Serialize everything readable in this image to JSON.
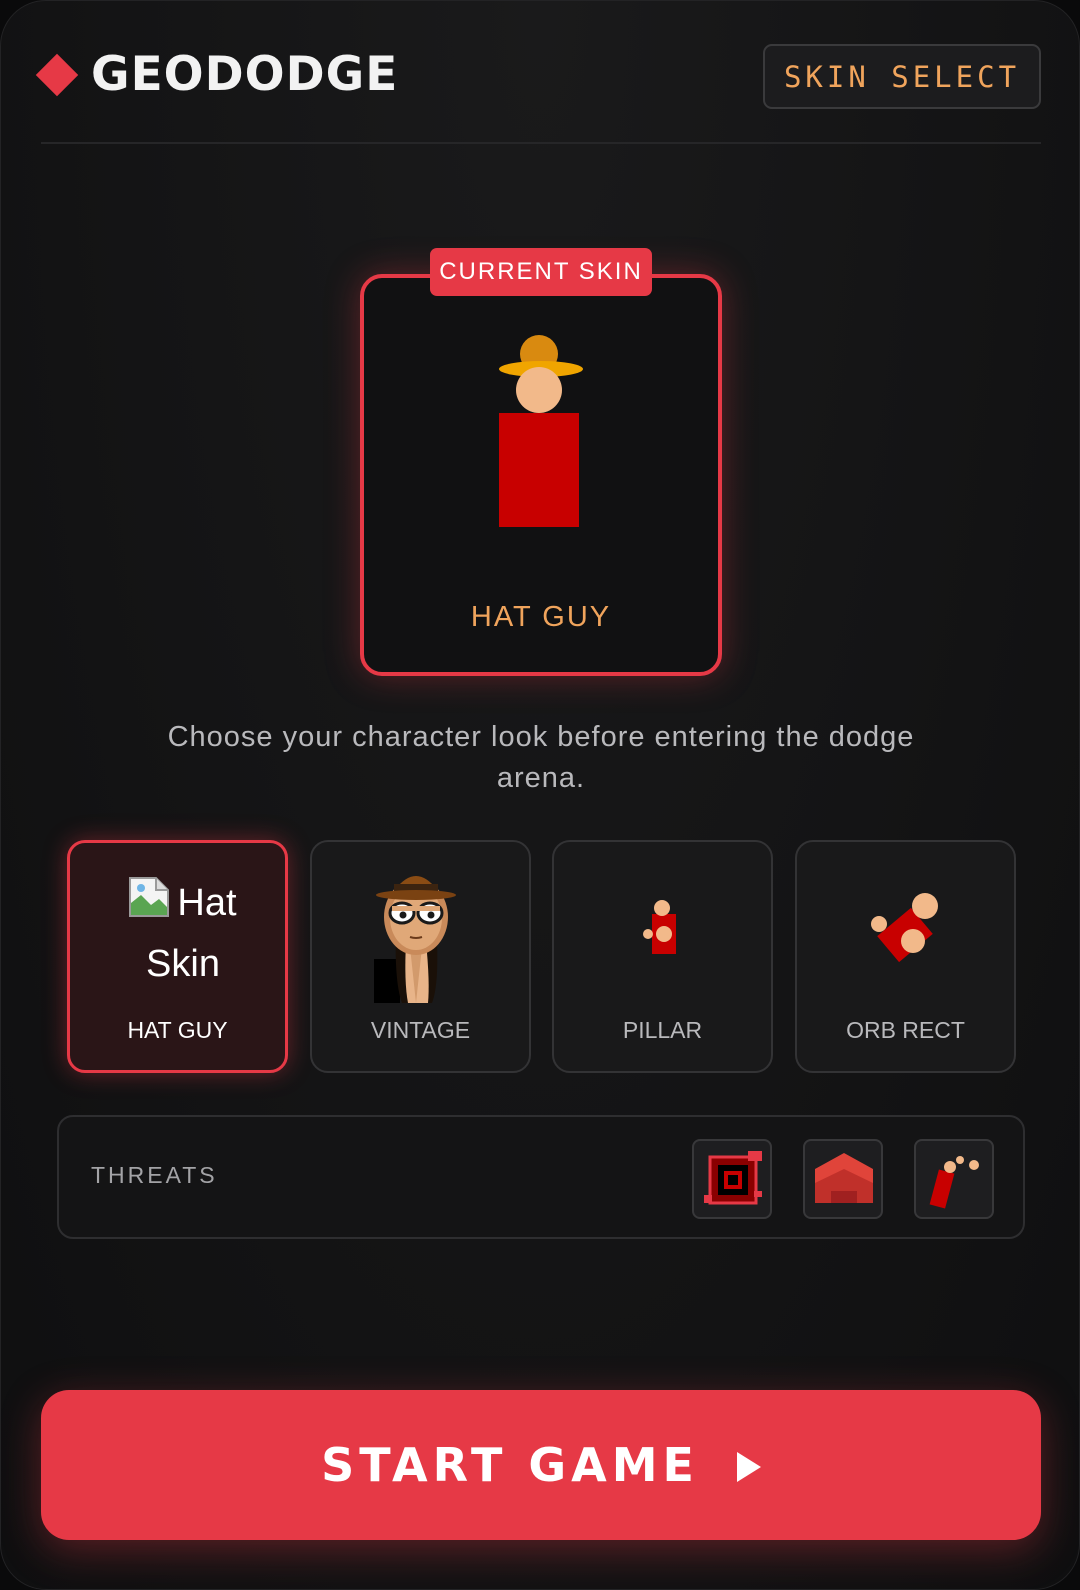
{
  "app": {
    "title": "GEODODGE",
    "skin_select_label": "SKIN SELECT",
    "accent_color": "#e63946",
    "secondary_accent": "#f0a45c"
  },
  "current_skin": {
    "badge": "CURRENT SKIN",
    "name": "HAT GUY"
  },
  "subtitle": "Choose your character look before entering the dodge arena.",
  "skins": [
    {
      "name": "HAT GUY",
      "image_alt": "Hat Skin",
      "selected": true,
      "icon": "broken-image-icon"
    },
    {
      "name": "VINTAGE",
      "selected": false,
      "icon": "vintage-character-icon"
    },
    {
      "name": "PILLAR",
      "selected": false,
      "icon": "pillar-character-icon"
    },
    {
      "name": "ORB RECT",
      "selected": false,
      "icon": "orb-rect-character-icon"
    }
  ],
  "threats": {
    "label": "THREATS",
    "items": [
      "square-trap-icon",
      "house-block-icon",
      "orb-shot-icon"
    ]
  },
  "start_button": {
    "label": "START GAME",
    "icon": "play-icon"
  }
}
